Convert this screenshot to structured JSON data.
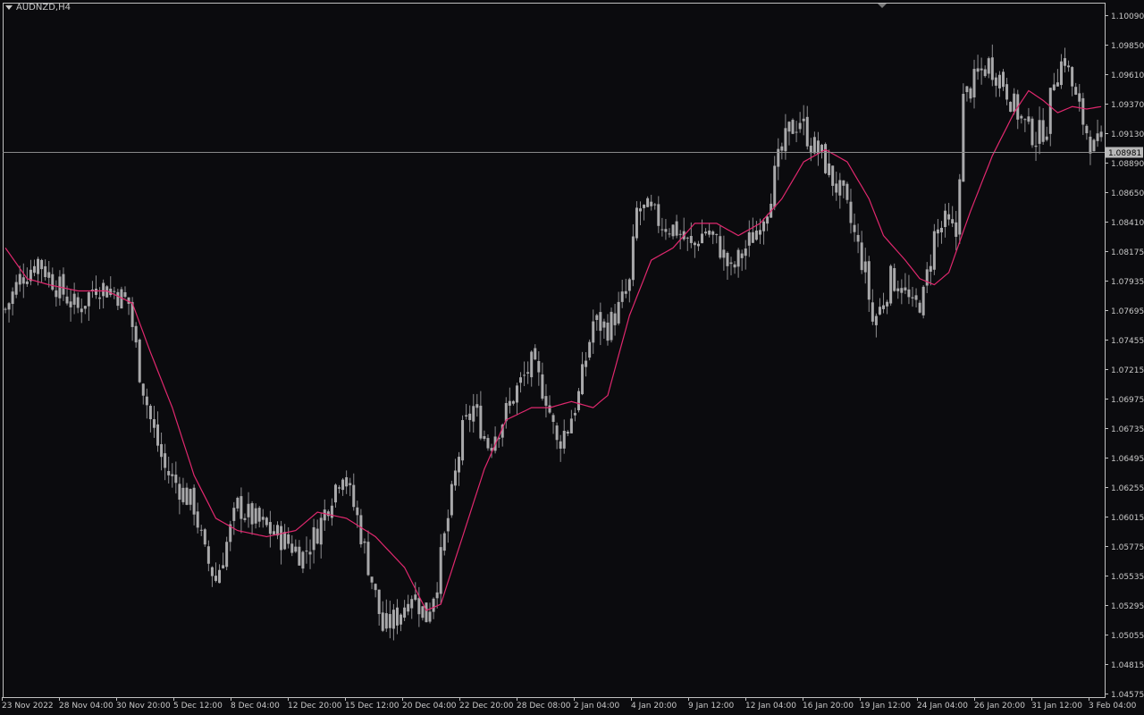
{
  "window": {
    "title": "AUDNZD,H4"
  },
  "colors": {
    "background": "#0b0b0e",
    "frame": "#c0c0c0",
    "candle": "#a9a9ab",
    "wick": "#8d8d90",
    "ma": "#e0286e",
    "price_line": "#8a8a8a",
    "price_tag_bg": "#b9b9b9",
    "text": "#c8c8c8"
  },
  "chart_data": {
    "type": "line",
    "symbol": "AUDNZD",
    "timeframe": "H4",
    "grid": false,
    "ylim": [
      1.0457,
      1.1009
    ],
    "current_price": "1.08981",
    "current_price_value": 1.08981,
    "y_ticks": [
      "1.10090",
      "1.09850",
      "1.09610",
      "1.09370",
      "1.09130",
      "1.08890",
      "1.08650",
      "1.08410",
      "1.08175",
      "1.07935",
      "1.07695",
      "1.07455",
      "1.07215",
      "1.06975",
      "1.06735",
      "1.06495",
      "1.06255",
      "1.06015",
      "1.05775",
      "1.05535",
      "1.05295",
      "1.05055",
      "1.04815",
      "1.04575"
    ],
    "x_ticks": [
      "23 Nov 2022",
      "28 Nov 04:00",
      "30 Nov 20:00",
      "5 Dec 12:00",
      "8 Dec 04:00",
      "12 Dec 20:00",
      "15 Dec 12:00",
      "20 Dec 04:00",
      "22 Dec 20:00",
      "28 Dec 08:00",
      "2 Jan 04:00",
      "4 Jan 20:00",
      "9 Jan 12:00",
      "12 Jan 04:00",
      "16 Jan 20:00",
      "19 Jan 12:00",
      "24 Jan 04:00",
      "26 Jan 20:00",
      "31 Jan 12:00",
      "3 Feb 04:00"
    ],
    "anchors": [
      {
        "i": 0,
        "c": 1.077
      },
      {
        "i": 4,
        "c": 1.0795
      },
      {
        "i": 9,
        "c": 1.081
      },
      {
        "i": 14,
        "c": 1.079
      },
      {
        "i": 20,
        "c": 1.077
      },
      {
        "i": 25,
        "c": 1.079
      },
      {
        "i": 30,
        "c": 1.0785
      },
      {
        "i": 34,
        "c": 1.0775
      },
      {
        "i": 37,
        "c": 1.072
      },
      {
        "i": 40,
        "c": 1.068
      },
      {
        "i": 44,
        "c": 1.064
      },
      {
        "i": 48,
        "c": 1.0625
      },
      {
        "i": 52,
        "c": 1.061
      },
      {
        "i": 55,
        "c": 1.057
      },
      {
        "i": 58,
        "c": 1.055
      },
      {
        "i": 61,
        "c": 1.058
      },
      {
        "i": 64,
        "c": 1.061
      },
      {
        "i": 68,
        "c": 1.06
      },
      {
        "i": 73,
        "c": 1.059
      },
      {
        "i": 78,
        "c": 1.058
      },
      {
        "i": 82,
        "c": 1.057
      },
      {
        "i": 86,
        "c": 1.059
      },
      {
        "i": 90,
        "c": 1.062
      },
      {
        "i": 93,
        "c": 1.064
      },
      {
        "i": 97,
        "c": 1.06
      },
      {
        "i": 101,
        "c": 1.055
      },
      {
        "i": 104,
        "c": 1.051
      },
      {
        "i": 108,
        "c": 1.052
      },
      {
        "i": 112,
        "c": 1.054
      },
      {
        "i": 116,
        "c": 1.052
      },
      {
        "i": 119,
        "c": 1.055
      },
      {
        "i": 122,
        "c": 1.06
      },
      {
        "i": 126,
        "c": 1.067
      },
      {
        "i": 129,
        "c": 1.069
      },
      {
        "i": 133,
        "c": 1.066
      },
      {
        "i": 137,
        "c": 1.068
      },
      {
        "i": 141,
        "c": 1.0705
      },
      {
        "i": 145,
        "c": 1.0725
      },
      {
        "i": 149,
        "c": 1.07
      },
      {
        "i": 152,
        "c": 1.066
      },
      {
        "i": 155,
        "c": 1.0675
      },
      {
        "i": 158,
        "c": 1.07
      },
      {
        "i": 162,
        "c": 1.076
      },
      {
        "i": 166,
        "c": 1.0755
      },
      {
        "i": 169,
        "c": 1.077
      },
      {
        "i": 172,
        "c": 1.079
      },
      {
        "i": 174,
        "c": 1.085
      },
      {
        "i": 177,
        "c": 1.085
      },
      {
        "i": 181,
        "c": 1.084
      },
      {
        "i": 185,
        "c": 1.0835
      },
      {
        "i": 189,
        "c": 1.082
      },
      {
        "i": 193,
        "c": 1.0835
      },
      {
        "i": 197,
        "c": 1.082
      },
      {
        "i": 200,
        "c": 1.08
      },
      {
        "i": 203,
        "c": 1.0815
      },
      {
        "i": 207,
        "c": 1.0835
      },
      {
        "i": 210,
        "c": 1.0855
      },
      {
        "i": 213,
        "c": 1.089
      },
      {
        "i": 216,
        "c": 1.0915
      },
      {
        "i": 219,
        "c": 1.0925
      },
      {
        "i": 222,
        "c": 1.0905
      },
      {
        "i": 225,
        "c": 1.0895
      },
      {
        "i": 228,
        "c": 1.0875
      },
      {
        "i": 231,
        "c": 1.086
      },
      {
        "i": 234,
        "c": 1.083
      },
      {
        "i": 237,
        "c": 1.08
      },
      {
        "i": 239,
        "c": 1.076
      },
      {
        "i": 241,
        "c": 1.077
      },
      {
        "i": 244,
        "c": 1.0795
      },
      {
        "i": 247,
        "c": 1.079
      },
      {
        "i": 250,
        "c": 1.077
      },
      {
        "i": 253,
        "c": 1.078
      },
      {
        "i": 256,
        "c": 1.083
      },
      {
        "i": 259,
        "c": 1.084
      },
      {
        "i": 262,
        "c": 1.083
      },
      {
        "i": 264,
        "c": 1.094
      },
      {
        "i": 268,
        "c": 1.096
      },
      {
        "i": 271,
        "c": 1.097
      },
      {
        "i": 275,
        "c": 1.0955
      },
      {
        "i": 278,
        "c": 1.0935
      },
      {
        "i": 281,
        "c": 1.092
      },
      {
        "i": 284,
        "c": 1.091
      },
      {
        "i": 287,
        "c": 1.092
      },
      {
        "i": 289,
        "c": 1.096
      },
      {
        "i": 292,
        "c": 1.0975
      },
      {
        "i": 295,
        "c": 1.094
      },
      {
        "i": 298,
        "c": 1.0915
      },
      {
        "i": 300,
        "c": 1.09
      },
      {
        "i": 302,
        "c": 1.0905
      }
    ],
    "ma_points": [
      {
        "i": 0,
        "v": 1.082
      },
      {
        "i": 6,
        "v": 1.0795
      },
      {
        "i": 12,
        "v": 1.079
      },
      {
        "i": 20,
        "v": 1.0785
      },
      {
        "i": 28,
        "v": 1.0785
      },
      {
        "i": 35,
        "v": 1.0775
      },
      {
        "i": 40,
        "v": 1.0735
      },
      {
        "i": 46,
        "v": 1.069
      },
      {
        "i": 52,
        "v": 1.0635
      },
      {
        "i": 58,
        "v": 1.06
      },
      {
        "i": 64,
        "v": 1.059
      },
      {
        "i": 72,
        "v": 1.0585
      },
      {
        "i": 80,
        "v": 1.059
      },
      {
        "i": 86,
        "v": 1.0605
      },
      {
        "i": 94,
        "v": 1.06
      },
      {
        "i": 102,
        "v": 1.0585
      },
      {
        "i": 110,
        "v": 1.056
      },
      {
        "i": 116,
        "v": 1.0525
      },
      {
        "i": 120,
        "v": 1.053
      },
      {
        "i": 126,
        "v": 1.0585
      },
      {
        "i": 132,
        "v": 1.064
      },
      {
        "i": 138,
        "v": 1.068
      },
      {
        "i": 145,
        "v": 1.069
      },
      {
        "i": 150,
        "v": 1.069
      },
      {
        "i": 156,
        "v": 1.0695
      },
      {
        "i": 162,
        "v": 1.069
      },
      {
        "i": 166,
        "v": 1.07
      },
      {
        "i": 172,
        "v": 1.0765
      },
      {
        "i": 178,
        "v": 1.081
      },
      {
        "i": 184,
        "v": 1.082
      },
      {
        "i": 190,
        "v": 1.084
      },
      {
        "i": 196,
        "v": 1.084
      },
      {
        "i": 202,
        "v": 1.083
      },
      {
        "i": 208,
        "v": 1.084
      },
      {
        "i": 214,
        "v": 1.086
      },
      {
        "i": 220,
        "v": 1.089
      },
      {
        "i": 226,
        "v": 1.09
      },
      {
        "i": 232,
        "v": 1.089
      },
      {
        "i": 238,
        "v": 1.086
      },
      {
        "i": 242,
        "v": 1.083
      },
      {
        "i": 248,
        "v": 1.081
      },
      {
        "i": 252,
        "v": 1.0795
      },
      {
        "i": 256,
        "v": 1.079
      },
      {
        "i": 260,
        "v": 1.08
      },
      {
        "i": 266,
        "v": 1.085
      },
      {
        "i": 272,
        "v": 1.0895
      },
      {
        "i": 278,
        "v": 1.093
      },
      {
        "i": 282,
        "v": 1.0948
      },
      {
        "i": 286,
        "v": 1.094
      },
      {
        "i": 290,
        "v": 1.093
      },
      {
        "i": 294,
        "v": 1.0935
      },
      {
        "i": 298,
        "v": 1.0933
      },
      {
        "i": 302,
        "v": 1.0935
      }
    ]
  }
}
